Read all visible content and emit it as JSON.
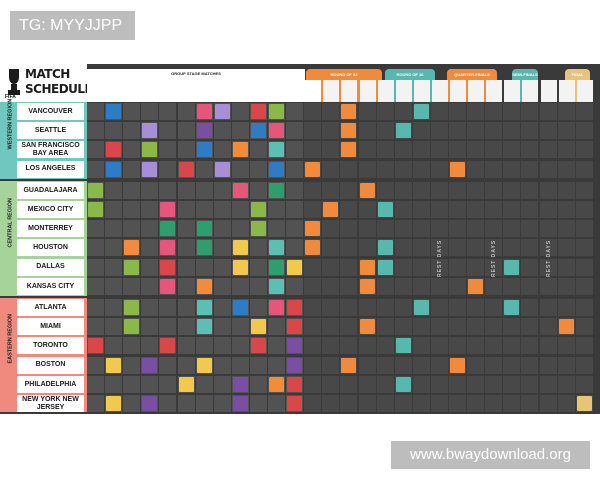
{
  "tag": "TG: MYYJJPP",
  "watermark": "www.bwaydownload.org",
  "poster": {
    "title_line1": "MATCH",
    "title_line2": "SCHEDULE",
    "brand": "FIFA",
    "group_stage_label": "GROUP STAGE MATCHES",
    "knockout_labels": [
      "ROUND OF 32",
      "ROUND OF 16",
      "QUARTER-FINALS",
      "SEMI-FINALS",
      "FINAL"
    ],
    "regions": [
      "WESTERN REGION",
      "CENTRAL REGION",
      "EASTERN REGION"
    ],
    "cities": [
      "VANCOUVER",
      "SEATTLE",
      "SAN FRANCISCO BAY AREA",
      "LOS ANGELES",
      "GUADALAJARA",
      "MEXICO CITY",
      "MONTERREY",
      "HOUSTON",
      "DALLAS",
      "KANSAS CITY",
      "ATLANTA",
      "MIAMI",
      "TORONTO",
      "BOSTON",
      "PHILADELPHIA",
      "NEW YORK NEW JERSEY"
    ],
    "rest_days_label": "REST DAYS",
    "colors": {
      "background": "#3a3a3a",
      "cell": "#525252",
      "western": "#6fc7bf",
      "central": "#a6d39a",
      "eastern": "#f08a7e",
      "round_of_32": "#f08a3c",
      "round_of_16": "#58b8b0",
      "quarter_finals": "#f08a3c",
      "semi_finals": "#58b8b0",
      "final": "#e8c37a"
    }
  }
}
